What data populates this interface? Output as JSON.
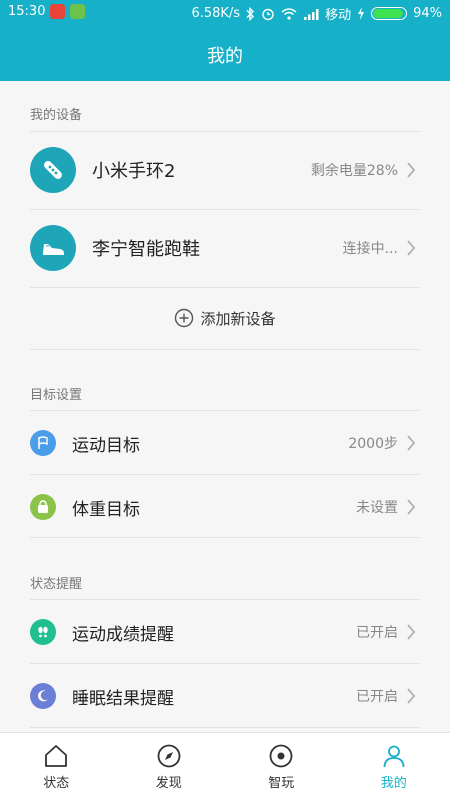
{
  "status_bar": {
    "time": "15:30",
    "speed": "6.58K/s",
    "carrier": "移动",
    "battery": "94%",
    "battery_level": 0.94
  },
  "header": {
    "title": "我的"
  },
  "sections": {
    "devices": {
      "title": "我的设备",
      "items": [
        {
          "label": "小米手环2",
          "value": "剩余电量28%",
          "icon": "band-icon"
        },
        {
          "label": "李宁智能跑鞋",
          "value": "连接中...",
          "icon": "shoe-icon"
        }
      ],
      "add_label": "添加新设备"
    },
    "goals": {
      "title": "目标设置",
      "items": [
        {
          "label": "运动目标",
          "value": "2000步",
          "icon": "flag-icon"
        },
        {
          "label": "体重目标",
          "value": "未设置",
          "icon": "weight-icon"
        }
      ]
    },
    "reminders": {
      "title": "状态提醒",
      "items": [
        {
          "label": "运动成绩提醒",
          "value": "已开启",
          "icon": "footprints-icon"
        },
        {
          "label": "睡眠结果提醒",
          "value": "已开启",
          "icon": "moon-icon"
        }
      ]
    }
  },
  "tabs": [
    {
      "label": "状态",
      "icon": "home-icon"
    },
    {
      "label": "发现",
      "icon": "compass-icon"
    },
    {
      "label": "智玩",
      "icon": "target-icon"
    },
    {
      "label": "我的",
      "icon": "person-icon",
      "active": true
    }
  ],
  "colors": {
    "header": "#16b0c8",
    "device_icon": "#1ea6b8",
    "flag_icon": "#4a9de8",
    "weight_icon": "#8bc34a",
    "footprints_icon": "#1fbf8f",
    "moon_icon": "#6b7fd6",
    "tab_active": "#16b0c8"
  }
}
